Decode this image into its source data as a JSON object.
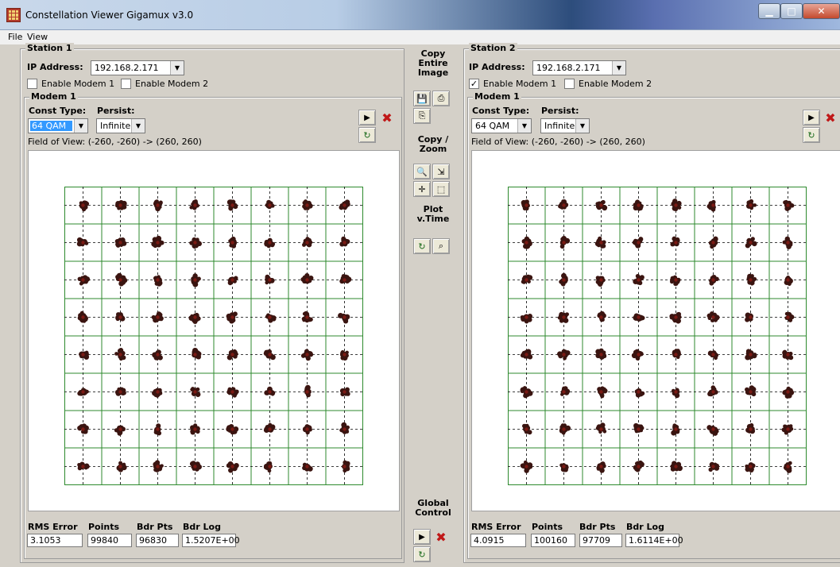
{
  "window": {
    "title": "Constellation Viewer Gigamux v3.0"
  },
  "menu": {
    "items": [
      "File",
      "View"
    ]
  },
  "colors": {
    "grid": "#2d8a2d",
    "point": "#3a1410",
    "title_gradient_dark": "#2d4d7c"
  },
  "stations": [
    {
      "title": "Station 1",
      "ip_label": "IP Address:",
      "ip_value": "192.168.2.171",
      "enable_modem1_label": "Enable Modem 1",
      "enable_modem1_checked": false,
      "enable_modem2_label": "Enable Modem 2",
      "enable_modem2_checked": false,
      "modem_title": "Modem 1",
      "const_type_label": "Const Type:",
      "const_type_value": "64 QAM",
      "persist_label": "Persist:",
      "persist_value": "Infinite",
      "fov_text": "Field of View: (-260, -260) -> (260, 260)",
      "stats_labels": [
        "RMS Error",
        "Points",
        "Bdr Pts",
        "Bdr Log"
      ],
      "stats_values": [
        "3.1053",
        "99840",
        "96830",
        "1.5207E+00"
      ],
      "seed": 3
    },
    {
      "title": "Station 2",
      "ip_label": "IP Address:",
      "ip_value": "192.168.2.171",
      "enable_modem1_label": "Enable Modem 1",
      "enable_modem1_checked": true,
      "enable_modem2_label": "Enable Modem 2",
      "enable_modem2_checked": false,
      "modem_title": "Modem 1",
      "const_type_label": "Const Type:",
      "const_type_value": "64 QAM",
      "persist_label": "Persist:",
      "persist_value": "Infinite",
      "fov_text": "Field of View: (-260, -260) -> (260, 260)",
      "stats_labels": [
        "RMS Error",
        "Points",
        "Bdr Pts",
        "Bdr Log"
      ],
      "stats_values": [
        "4.0915",
        "100160",
        "97709",
        "1.6114E+00"
      ],
      "seed": 11
    }
  ],
  "center_panel": {
    "copy_entire_image": "Copy Entire Image",
    "copy_zoom": "Copy / Zoom",
    "plot_vtime": "Plot v.Time",
    "global_control": "Global Control"
  },
  "constellation": {
    "rows": 8,
    "cols": 8
  }
}
